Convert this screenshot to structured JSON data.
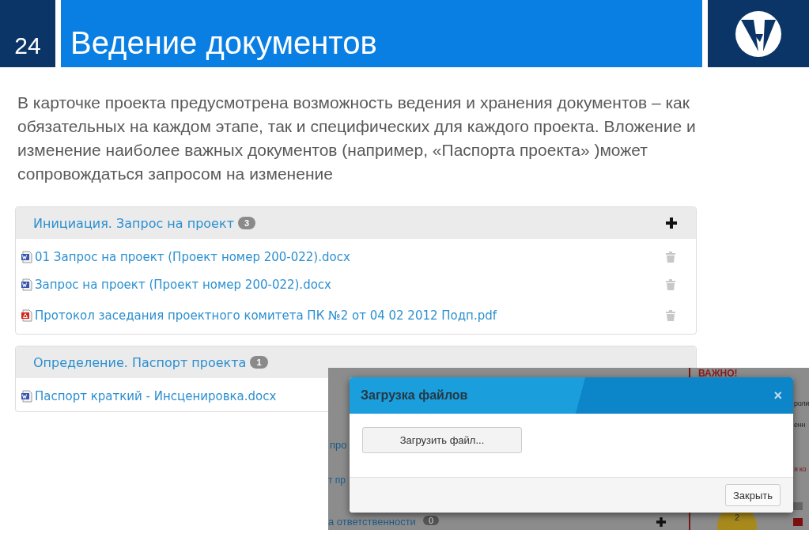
{
  "slide": {
    "number": "24",
    "title": "Ведение документов"
  },
  "description": "В карточке проекта предусмотрена возможность ведения и хранения документов – как обязательных на каждом этапе, так и специфических для каждого проекта. Вложение и изменение наиболее важных документов (например, «Паспорта проекта» )может сопровождаться запросом на изменение",
  "panels": [
    {
      "title": "Инициация. Запрос на проект",
      "count": "3",
      "actions": true,
      "files": [
        {
          "name": "01 Запрос на проект (Проект номер 200-022).docx",
          "kind": "docx"
        },
        {
          "name": "Запрос на проект (Проект номер 200-022).docx",
          "kind": "docx"
        },
        {
          "name": "Протокол заседания проектного комитета ПК №2 от 04 02 2012 Подп.pdf",
          "kind": "pdf"
        }
      ]
    },
    {
      "title": "Определение. Паспорт проекта",
      "count": "1",
      "actions": false,
      "files": [
        {
          "name": "Паспорт краткий - Инсценировка.docx",
          "kind": "docx"
        }
      ]
    }
  ],
  "background_page": {
    "notice": "ВАЖНО!",
    "right_lines": [
      "роли",
      "енн",
      "я ко"
    ],
    "left_links": [
      "про",
      "т пр"
    ],
    "section": {
      "title": "а ответственности",
      "count": "0"
    },
    "chart_label": "2"
  },
  "dialog": {
    "title": "Загрузка файлов",
    "close_icon": "×",
    "upload_button": "Загрузить файл...",
    "close_button": "Закрыть"
  }
}
